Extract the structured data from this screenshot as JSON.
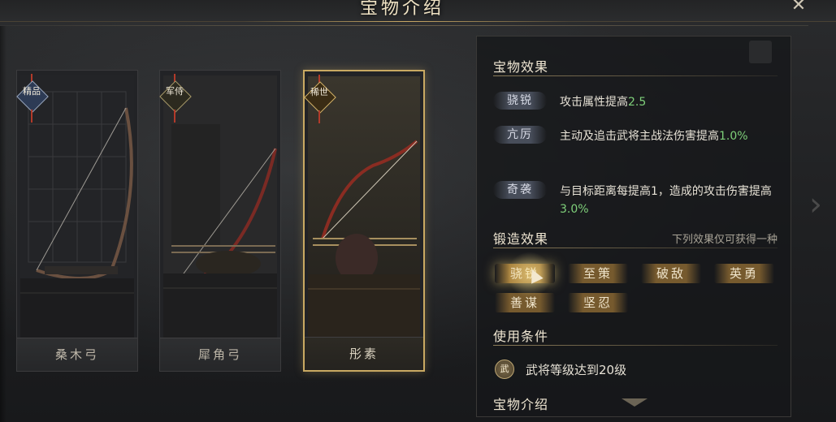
{
  "header": {
    "title": "宝物介绍",
    "close_icon": "close-x-icon"
  },
  "treasures": [
    {
      "name": "桑木弓",
      "rarity": "精品",
      "rarity_color": "#2d3b55",
      "selected": false
    },
    {
      "name": "犀角弓",
      "rarity": "军侍",
      "rarity_color": "#2c2a1f",
      "selected": false
    },
    {
      "name": "彤素",
      "rarity": "稀世",
      "rarity_color": "#3a2c14",
      "selected": true
    }
  ],
  "detail": {
    "effects_title": "宝物效果",
    "effects": [
      {
        "tag": "骁锐",
        "text_before": "攻击属性提高",
        "value": "2.5",
        "text_after": ""
      },
      {
        "tag": "亢厉",
        "text_before": "主动及追击武将主战法伤害提高",
        "value": "1.0%",
        "text_after": ""
      },
      {
        "tag": "奇袭",
        "text_before": "与目标距离每提高1，造成的攻击伤害提高",
        "value": "3.0%",
        "text_after": ""
      }
    ],
    "forge_title": "锻造效果",
    "forge_note": "下列效果仅可获得一种",
    "forge_options": [
      "骁锐",
      "至策",
      "破敌",
      "英勇",
      "善谋",
      "坚忍"
    ],
    "forge_active_index": 0,
    "condition_title": "使用条件",
    "condition_icon_label": "武",
    "condition_text": "武将等级达到20级",
    "intro_title": "宝物介绍"
  },
  "colors": {
    "accent_gold": "#c9a962",
    "highlight_green": "#7fd07a",
    "text": "#e7e2d6"
  }
}
